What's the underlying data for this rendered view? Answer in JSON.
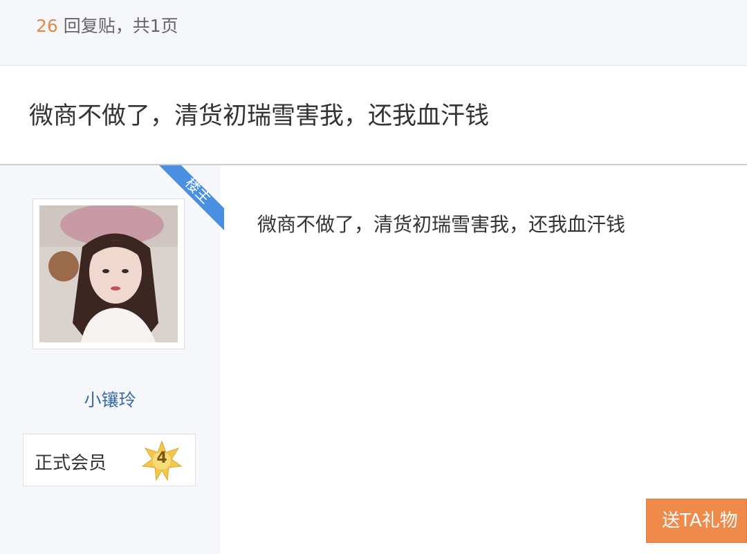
{
  "header": {
    "reply_count": "26",
    "reply_text": "回复贴，共1页"
  },
  "thread": {
    "title": "微商不做了，清货初瑞雪害我，还我血汗钱"
  },
  "post": {
    "owner_tag": "楼主",
    "content": "微商不做了，清货初瑞雪害我，还我血汗钱",
    "gift_button_label": "送TA礼物"
  },
  "author": {
    "name": "小镶玲",
    "rank": "正式会员",
    "level": "4"
  },
  "colors": {
    "accent_orange": "#f08a4b",
    "owner_tag_blue": "#4a90e2",
    "username_blue": "#3b6aa8",
    "reply_count_orange": "#e0894a",
    "level_badge_gold": "#f3c74a"
  },
  "icons": {
    "owner_corner": "corner-ribbon",
    "level_badge": "star-badge-icon"
  }
}
